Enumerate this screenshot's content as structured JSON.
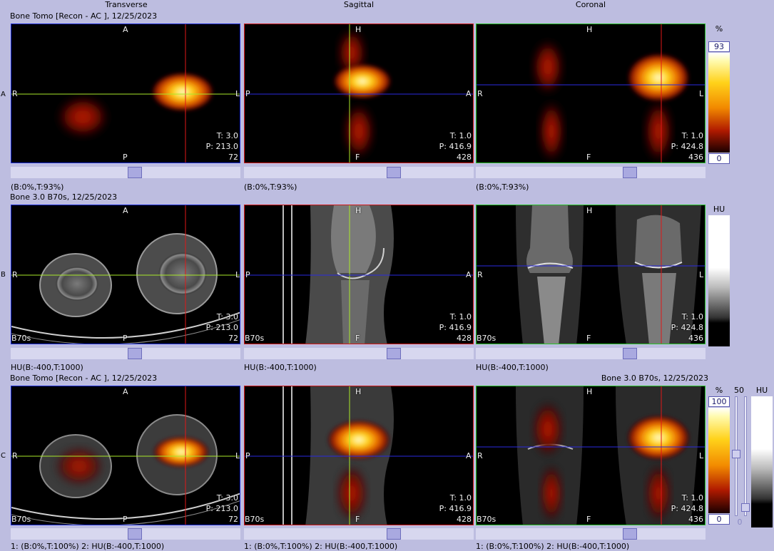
{
  "columns": {
    "transverse": "Transverse",
    "sagittal": "Sagittal",
    "coronal": "Coronal"
  },
  "rows": [
    {
      "letter": "A",
      "title": "Bone Tomo [Recon - AC ], 12/25/2023",
      "window_labels": [
        "(B:0%,T:93%)",
        "(B:0%,T:93%)",
        "(B:0%,T:93%)"
      ]
    },
    {
      "letter": "B",
      "title": "Bone  3.0  B70s, 12/25/2023",
      "window_labels": [
        "HU(B:-400,T:1000)",
        "HU(B:-400,T:1000)",
        "HU(B:-400,T:1000)"
      ]
    },
    {
      "letter": "C",
      "title": "Bone Tomo [Recon - AC ], 12/25/2023",
      "title_right": "Bone  3.0  B70s, 12/25/2023",
      "window_labels": [
        "1: (B:0%,T:100%)    2: HU(B:-400,T:1000)",
        "1: (B:0%,T:100%)    2: HU(B:-400,T:1000)",
        "1: (B:0%,T:100%)    2: HU(B:-400,T:1000)"
      ]
    }
  ],
  "orientation": {
    "transverse": {
      "top": "A",
      "bottom": "P",
      "left": "R",
      "right": "L"
    },
    "sagittal": {
      "top": "H",
      "bottom": "F",
      "left": "P",
      "right": "A"
    },
    "coronal": {
      "top": "H",
      "bottom": "F",
      "left": "R",
      "right": "L"
    }
  },
  "slice_info": {
    "transverse": {
      "t": "T: 3.0",
      "p": "P: 213.0",
      "n": "72"
    },
    "sagittal": {
      "t": "T: 1.0",
      "p": "P: 416.9",
      "n": "428"
    },
    "coronal": {
      "t": "T: 1.0",
      "p": "P: 424.8",
      "n": "436"
    }
  },
  "kernel_label": "B70s",
  "colorbars": {
    "pet": {
      "unit": "%",
      "top_value": "93",
      "bottom_value": "0"
    },
    "ct": {
      "unit": "HU"
    },
    "fused": {
      "unit": "%",
      "top_value": "100",
      "bottom_value": "0",
      "mix_label": "50",
      "mix_bottom": "0",
      "ct_unit": "HU"
    }
  },
  "colors": {
    "transverse_border": "#1a2bd6",
    "sagittal_border": "#d21818",
    "coronal_border": "#27c227",
    "background": "#bdbde0"
  }
}
